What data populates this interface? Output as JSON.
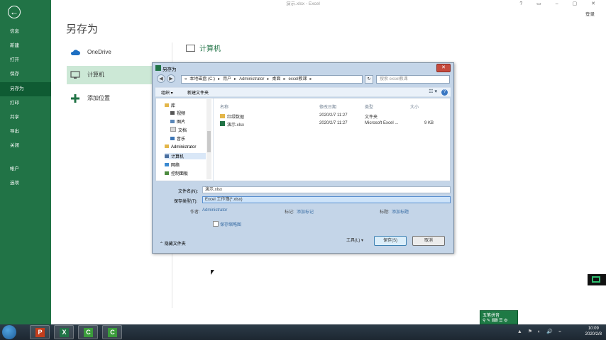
{
  "window": {
    "title": "演示.xlsx - Excel",
    "controls": "? ▭ – ▢ ✕",
    "sign_in": "登录"
  },
  "backstage": {
    "back": "←",
    "items": [
      "信息",
      "新建",
      "打开",
      "保存",
      "另存为",
      "打印",
      "共享",
      "导出",
      "关闭",
      "帐户",
      "选项"
    ],
    "heading": "另存为",
    "locations": [
      "OneDrive",
      "计算机",
      "添加位置"
    ],
    "right_title": "计算机"
  },
  "dialog": {
    "title": "另存为",
    "close": "✕",
    "address": [
      "«",
      "本地磁盘 (C:)",
      "▸",
      "用户",
      "▸",
      "Administrator",
      "▸",
      "桌面",
      "▸",
      "excel教课",
      "▸"
    ],
    "search_placeholder": "搜索 excel教课",
    "organize": "组织 ▾",
    "new_folder": "新建文件夹",
    "view": "☷ ▾",
    "help": "?",
    "tree": [
      "库",
      "视频",
      "图片",
      "文档",
      "音乐",
      "Administrator",
      "计算机",
      "网络",
      "控制面板"
    ],
    "columns": [
      "名称",
      "修改日期",
      "类型",
      "大小"
    ],
    "files": [
      {
        "name": "红绿数据",
        "date": "2020/2/7 11:27",
        "type": "文件夹",
        "size": ""
      },
      {
        "name": "演示.xlsx",
        "date": "2020/2/7 11:27",
        "type": "Microsoft Excel ...",
        "size": "9 KB"
      }
    ],
    "filename_label": "文件名(N):",
    "filename": "演示.xlsx",
    "filetype_label": "保存类型(T):",
    "filetype": "Excel 工作簿(*.xlsx)",
    "author_label": "作者:",
    "author": "Administrator",
    "tags_label": "标记:",
    "tags": "添加标记",
    "title_label": "标题:",
    "title_value": "添加标题",
    "thumbnail": "保存缩略图",
    "hide_folders": "隐藏文件夹",
    "tools": "工具(L)",
    "save": "保存(S)",
    "cancel": "取消"
  },
  "ime": {
    "line1": "五笔拼音",
    "line2": "⚲ ✎ ⌨ ☰ ⚙"
  },
  "taskbar": {
    "apps": [
      "P",
      "X",
      "C",
      "C"
    ],
    "time": "10:09",
    "date": "2020/2/8"
  },
  "colors": {
    "excel_green": "#217346",
    "dialog_chrome": "#c4d5e8"
  }
}
